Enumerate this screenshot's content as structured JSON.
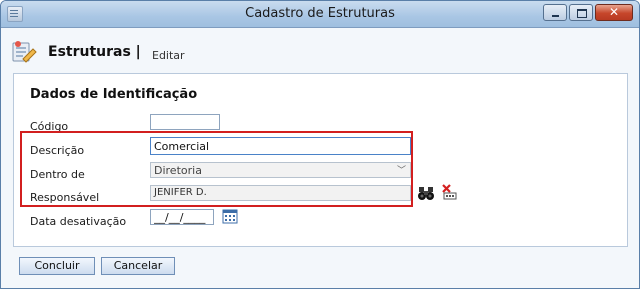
{
  "window": {
    "title": "Cadastro de Estruturas"
  },
  "header": {
    "title": "Estruturas |",
    "subtitle": "Editar"
  },
  "section": {
    "title": "Dados de Identificação"
  },
  "fields": {
    "codigo": {
      "label": "Código",
      "value": ""
    },
    "descricao": {
      "label": "Descrição",
      "value": "Comercial"
    },
    "dentro_de": {
      "label": "Dentro de",
      "value": "Diretoria"
    },
    "responsavel": {
      "label": "Responsável",
      "value": "JENIFER D."
    },
    "data_desativacao": {
      "label": "Data desativação",
      "value": "__/__/____"
    }
  },
  "buttons": {
    "concluir": "Concluir",
    "cancelar": "Cancelar"
  },
  "icons": {
    "app": "document-icon",
    "header": "structure-edit-icon",
    "search": "binoculars-icon",
    "clear": "delete-icon",
    "calendar": "calendar-icon"
  },
  "colors": {
    "highlight": "#d21f1f",
    "titlebar": "#a9c6e4",
    "close": "#c6462b"
  }
}
